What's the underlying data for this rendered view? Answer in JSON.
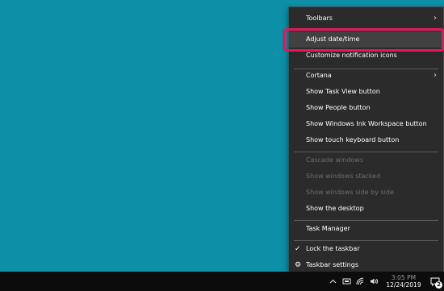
{
  "context_menu": {
    "items": [
      {
        "label": "Toolbars",
        "submenu": true
      },
      {
        "label": "Adjust date/time"
      },
      {
        "label": "Customize notification icons"
      },
      {
        "label": "Cortana",
        "submenu": true
      },
      {
        "label": "Show Task View button"
      },
      {
        "label": "Show People button"
      },
      {
        "label": "Show Windows Ink Workspace button"
      },
      {
        "label": "Show touch keyboard button"
      },
      {
        "label": "Cascade windows",
        "disabled": true
      },
      {
        "label": "Show windows stacked",
        "disabled": true
      },
      {
        "label": "Show windows side by side",
        "disabled": true
      },
      {
        "label": "Show the desktop"
      },
      {
        "label": "Task Manager"
      },
      {
        "label": "Lock the taskbar",
        "checked": true
      },
      {
        "label": "Taskbar settings",
        "icon": "gear-icon"
      }
    ],
    "submenu_arrow": "›",
    "check_glyph": "✓",
    "gear_glyph": "⚙"
  },
  "taskbar": {
    "clock": {
      "time": "3:05 PM",
      "date": "12/24/2019"
    },
    "notification_count": "2",
    "tray_icons": [
      "chevron-up-icon",
      "network-icon",
      "wifi-icon",
      "volume-icon"
    ]
  },
  "colors": {
    "desktop": "#0d8fa8",
    "menu_bg": "#2b2b2b",
    "highlight": "#e4175d"
  }
}
